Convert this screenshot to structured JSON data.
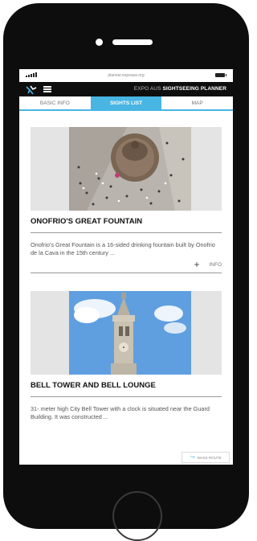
{
  "status": {
    "url": "planner.expoaus.org"
  },
  "app": {
    "title_prefix": "EXPO AUS",
    "title_main": "SIGHTSEEING PLANNER"
  },
  "tabs": [
    {
      "label": "BASIC INFO",
      "active": false
    },
    {
      "label": "SIGHTS LIST",
      "active": true
    },
    {
      "label": "MAP",
      "active": false
    }
  ],
  "sights": [
    {
      "title": "ONOFRIO'S GREAT FOUNTAIN",
      "description": "Onofrio's Great Fountain is a 16-sided drinking fountain built by Onofrio de la Cava in the 15th century ...",
      "info_label": "INFO",
      "image": "fountain-aerial-photo"
    },
    {
      "title": "BELL TOWER AND BELL LOUNGE",
      "description": "31- meter high City Bell Tower with a clock is situated near the Guard Building. It was constructed ...",
      "image": "bell-tower-photo"
    }
  ],
  "route_button": {
    "label": "MAKE ROUTE",
    "icon": "route-icon"
  },
  "colors": {
    "accent": "#48b5e3",
    "appbar": "#0e0e0e",
    "phone": "#0d0d0d"
  }
}
